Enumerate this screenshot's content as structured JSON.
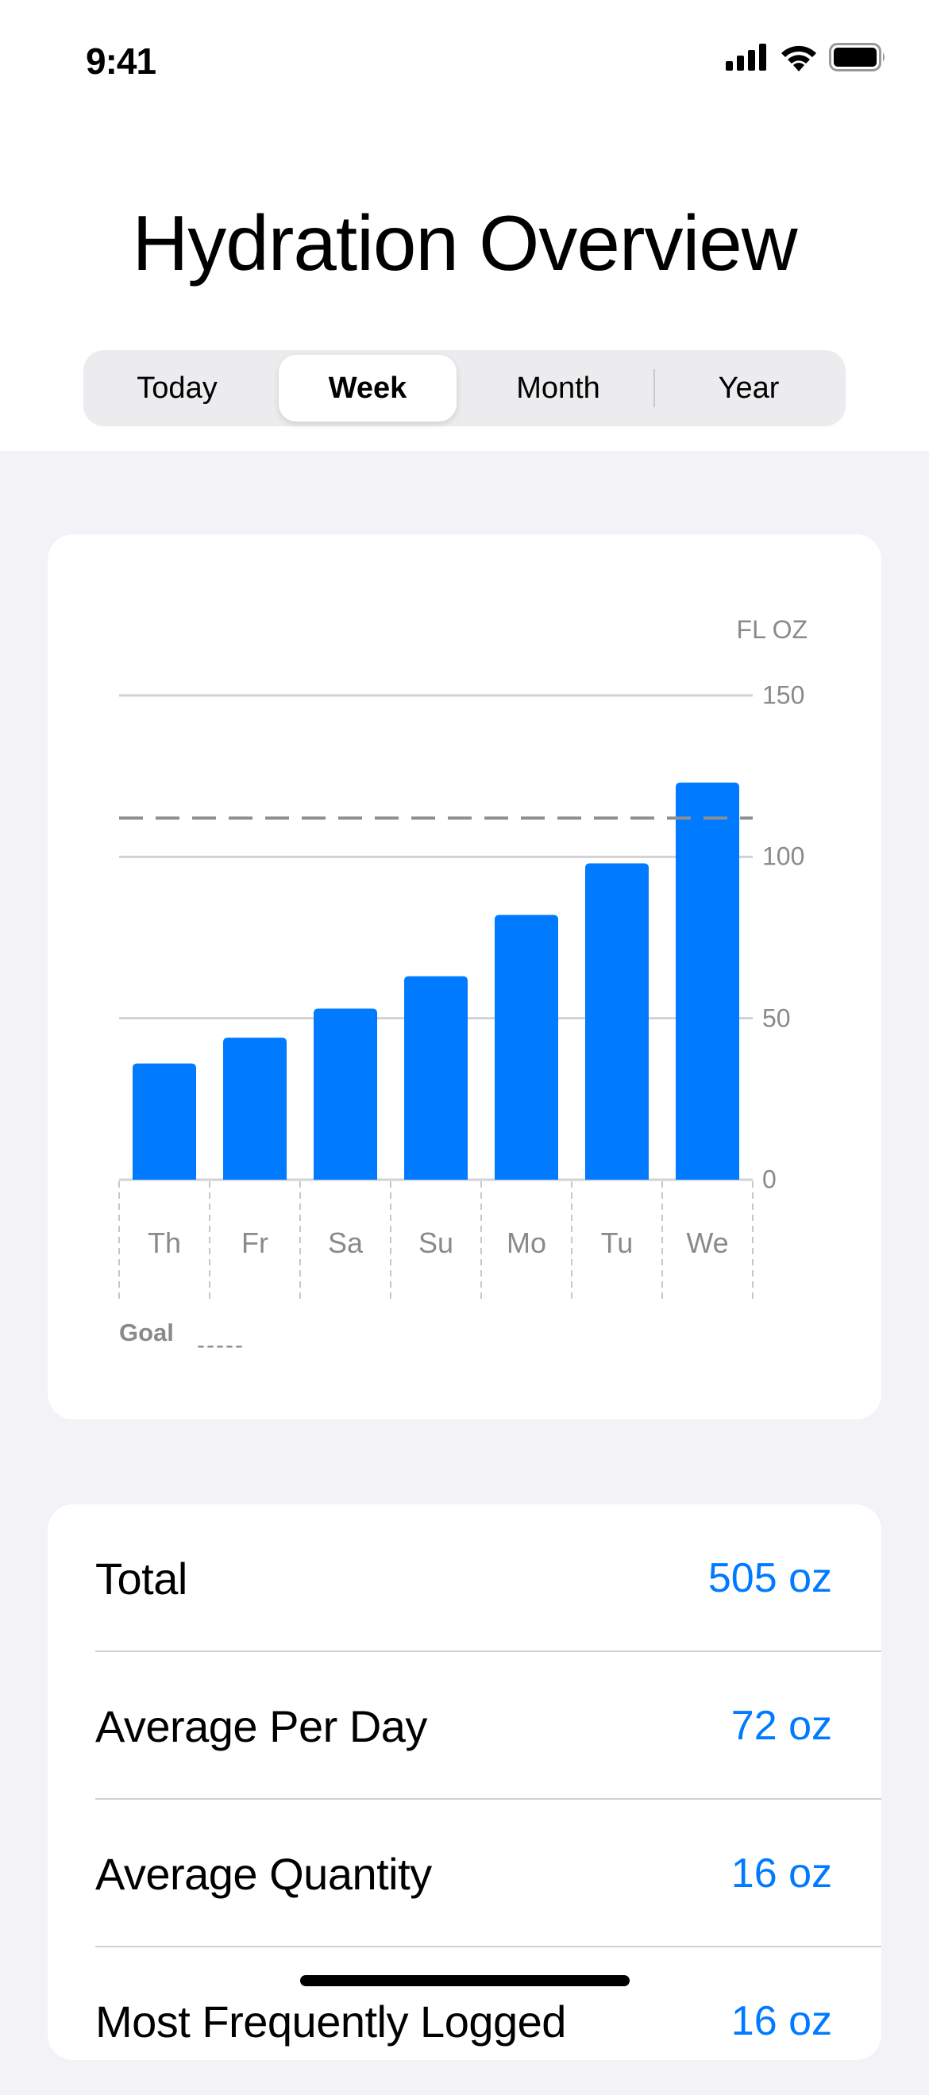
{
  "status_bar": {
    "time": "9:41",
    "icons": [
      "cellular-signal-icon",
      "wifi-icon",
      "battery-icon"
    ]
  },
  "header": {
    "title": "Hydration Overview"
  },
  "segmented_control": {
    "options": [
      "Today",
      "Week",
      "Month",
      "Year"
    ],
    "selected": "Week"
  },
  "colors": {
    "accent": "#007aff",
    "background": "#f2f2f7",
    "secondary_text": "#8a8a8e"
  },
  "chart_data": {
    "type": "bar",
    "title": "",
    "unit_label": "FL OZ",
    "categories": [
      "Th",
      "Fr",
      "Sa",
      "Su",
      "Mo",
      "Tu",
      "We"
    ],
    "values": [
      36,
      44,
      53,
      63,
      82,
      98,
      123
    ],
    "goal": 112,
    "ylim": [
      0,
      150
    ],
    "yticks": [
      0,
      50,
      100,
      150
    ],
    "ytick_labels": [
      "0",
      "50",
      "100",
      "150"
    ],
    "xlabel": "",
    "ylabel": "FL OZ",
    "grid": true,
    "legend": {
      "label": "Goal",
      "symbol": "-----",
      "placement": "bottom-left"
    }
  },
  "stats": [
    {
      "label": "Total",
      "value": "505 oz"
    },
    {
      "label": "Average Per Day",
      "value": "72 oz"
    },
    {
      "label": "Average Quantity",
      "value": "16 oz"
    },
    {
      "label": "Most Frequently Logged",
      "value": "16 oz"
    }
  ]
}
